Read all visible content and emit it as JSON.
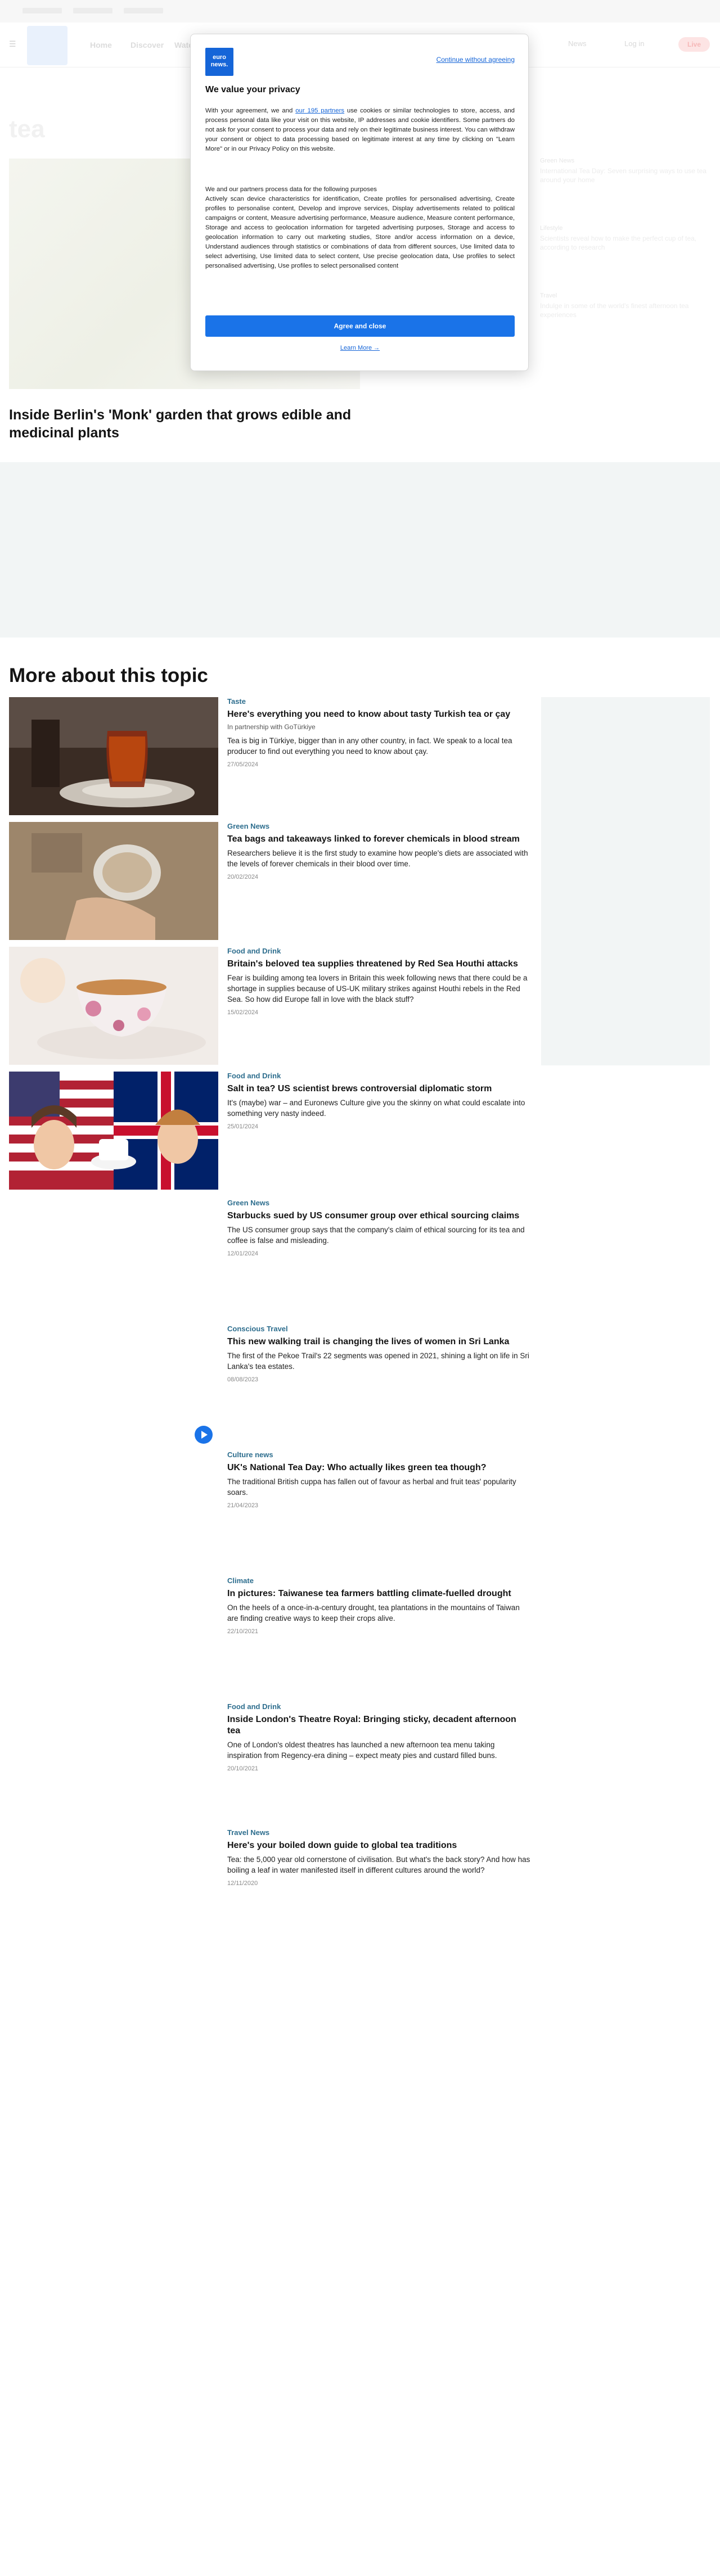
{
  "header": {
    "nav_items": [
      "Home",
      "Discover",
      "Watch"
    ],
    "right_items": [
      "News",
      "Log in"
    ],
    "live_label": "Live",
    "faded_title": "tea"
  },
  "hero": {
    "title": "Inside Berlin's 'Monk' garden that grows edible and medicinal plants"
  },
  "sidebar": {
    "items": [
      {
        "category": "Green News",
        "title": "International Tea Day: Seven surprising ways to use tea around your home"
      },
      {
        "category": "Lifestyle",
        "title": "Scientists reveal how to make the perfect cup of tea, according to research"
      },
      {
        "category": "Travel",
        "title": "Indulge in some of the world's finest afternoon tea experiences"
      }
    ]
  },
  "section": {
    "title": "More about this topic"
  },
  "articles": [
    {
      "category": "Taste",
      "title": "Here's everything you need to know about tasty Turkish tea or çay",
      "partner": "In partnership with GoTürkiye",
      "desc": "Tea is big in Türkiye, bigger than in any other country, in fact. We speak to a local tea producer to find out everything you need to know about çay.",
      "date": "27/05/2024"
    },
    {
      "category": "Green News",
      "title": "Tea bags and takeaways linked to forever chemicals in blood stream",
      "partner": "",
      "desc": "Researchers believe it is the first study to examine how people's diets are associated with the levels of forever chemicals in their blood over time.",
      "date": "20/02/2024"
    },
    {
      "category": "Food and Drink",
      "title": "Britain's beloved tea supplies threatened by Red Sea Houthi attacks",
      "partner": "",
      "desc": "Fear is building among tea lovers in Britain this week following news that there could be a shortage in supplies because of US-UK military strikes against Houthi rebels in the Red Sea. So how did Europe fall in love with the black stuff?",
      "date": "15/02/2024"
    },
    {
      "category": "Food and Drink",
      "title": "Salt in tea? US scientist brews controversial diplomatic storm",
      "partner": "",
      "desc": "It's (maybe) war – and Euronews Culture give you the skinny on what could escalate into something very nasty indeed.",
      "date": "25/01/2024"
    },
    {
      "category": "Green News",
      "title": "Starbucks sued by US consumer group over ethical sourcing claims",
      "partner": "",
      "desc": "The US consumer group says that the company's claim of ethical sourcing for its tea and coffee is false and misleading.",
      "date": "12/01/2024"
    },
    {
      "category": "Conscious Travel",
      "title": "This new walking trail is changing the lives of women in Sri Lanka",
      "partner": "",
      "desc": "The first of the Pekoe Trail's 22 segments was opened in 2021, shining a light on life in Sri Lanka's tea estates.",
      "date": "08/08/2023"
    },
    {
      "category": "Culture news",
      "title": "UK's National Tea Day: Who actually likes green tea though?",
      "partner": "",
      "desc": "The traditional British cuppa has fallen out of favour as herbal and fruit teas' popularity soars.",
      "date": "21/04/2023"
    },
    {
      "category": "Climate",
      "title": "In pictures: Taiwanese tea farmers battling climate-fuelled drought",
      "partner": "",
      "desc": "On the heels of a once-in-a-century drought, tea plantations in the mountains of Taiwan are finding creative ways to keep their crops alive.",
      "date": "22/10/2021"
    },
    {
      "category": "Food and Drink",
      "title": "Inside London's Theatre Royal: Bringing sticky, decadent afternoon tea",
      "partner": "",
      "desc": "One of London's oldest theatres has launched a new afternoon tea menu taking inspiration from Regency-era dining – expect meaty pies and custard filled buns.",
      "date": "20/10/2021"
    },
    {
      "category": "Travel News",
      "title": "Here's your boiled down guide to global tea traditions",
      "partner": "",
      "desc": "Tea: the 5,000 year old cornerstone of civilisation. But what's the back story? And how has boiling a leaf in water manifested itself in different cultures around the world?",
      "date": "12/11/2020"
    }
  ],
  "consent": {
    "logo_line1": "euro",
    "logo_line2": "news.",
    "continue_label": "Continue without agreeing",
    "title": "We value your privacy",
    "text_before": "With your agreement, we and ",
    "partners_link": "our 195 partners",
    "text_after": " use cookies or similar technologies to store, access, and process personal data like your visit on this website, IP addresses and cookie identifiers. Some partners do not ask for your consent to process your data and rely on their legitimate business interest. You can withdraw your consent or object to data processing based on legitimate interest at any time by clicking on \"Learn More\" or in our Privacy Policy on this website.",
    "purposes_intro": "We and our partners process data for the following purposes",
    "purposes": "Actively scan device characteristics for identification, Create profiles for personalised advertising, Create profiles to personalise content, Develop and improve services, Display advertisements related to political campaigns or content, Measure advertising performance, Measure audience, Measure content performance, Storage and access to geolocation information for targeted advertising purposes, Storage and access to geolocation information to carry out marketing studies, Store and/or access information on a device, Understand audiences through statistics or combinations of data from different sources, Use limited data to select advertising, Use limited data to select content, Use precise geolocation data, Use profiles to select personalised advertising, Use profiles to select personalised content",
    "agree_label": "Agree and close",
    "learn_label": "Learn More →"
  }
}
